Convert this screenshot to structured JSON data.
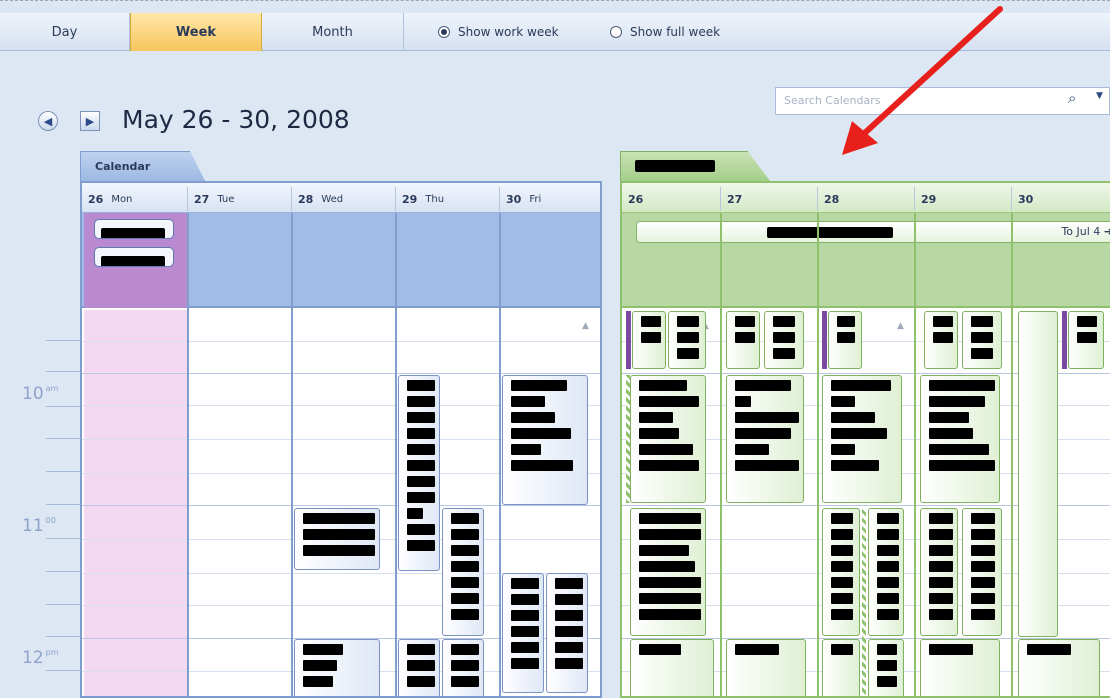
{
  "view_tabs": [
    {
      "label": "Day",
      "active": false
    },
    {
      "label": "Week",
      "active": true
    },
    {
      "label": "Month",
      "active": false
    }
  ],
  "week_options": [
    {
      "label": "Show work week",
      "selected": true
    },
    {
      "label": "Show full week",
      "selected": false
    }
  ],
  "date_range": "May 26 - 30, 2008",
  "search": {
    "placeholder": "Search Calendars"
  },
  "icons": {
    "back": "back-arrow-icon",
    "forward": "forward-arrow-icon",
    "search": "search-icon"
  },
  "colors": {
    "accent_tab": "#f7c55c",
    "blue_calendar": "#7f9dcd",
    "green_calendar": "#8fc06c",
    "annotation_arrow": "#e8201c"
  },
  "blue_calendar": {
    "tab_label": "Calendar",
    "days": [
      {
        "num": "26",
        "name": "Mon"
      },
      {
        "num": "27",
        "name": "Tue"
      },
      {
        "num": "28",
        "name": "Wed"
      },
      {
        "num": "29",
        "name": "Thu"
      },
      {
        "num": "30",
        "name": "Fri"
      }
    ]
  },
  "green_calendar": {
    "days": [
      {
        "num": "26"
      },
      {
        "num": "27"
      },
      {
        "num": "28"
      },
      {
        "num": "29"
      },
      {
        "num": "30"
      }
    ],
    "allday_continues": "To Jul 4"
  },
  "times": [
    {
      "hour": "10",
      "suffix": "am"
    },
    {
      "hour": "11",
      "suffix": "00"
    },
    {
      "hour": "12",
      "suffix": "pm"
    }
  ]
}
